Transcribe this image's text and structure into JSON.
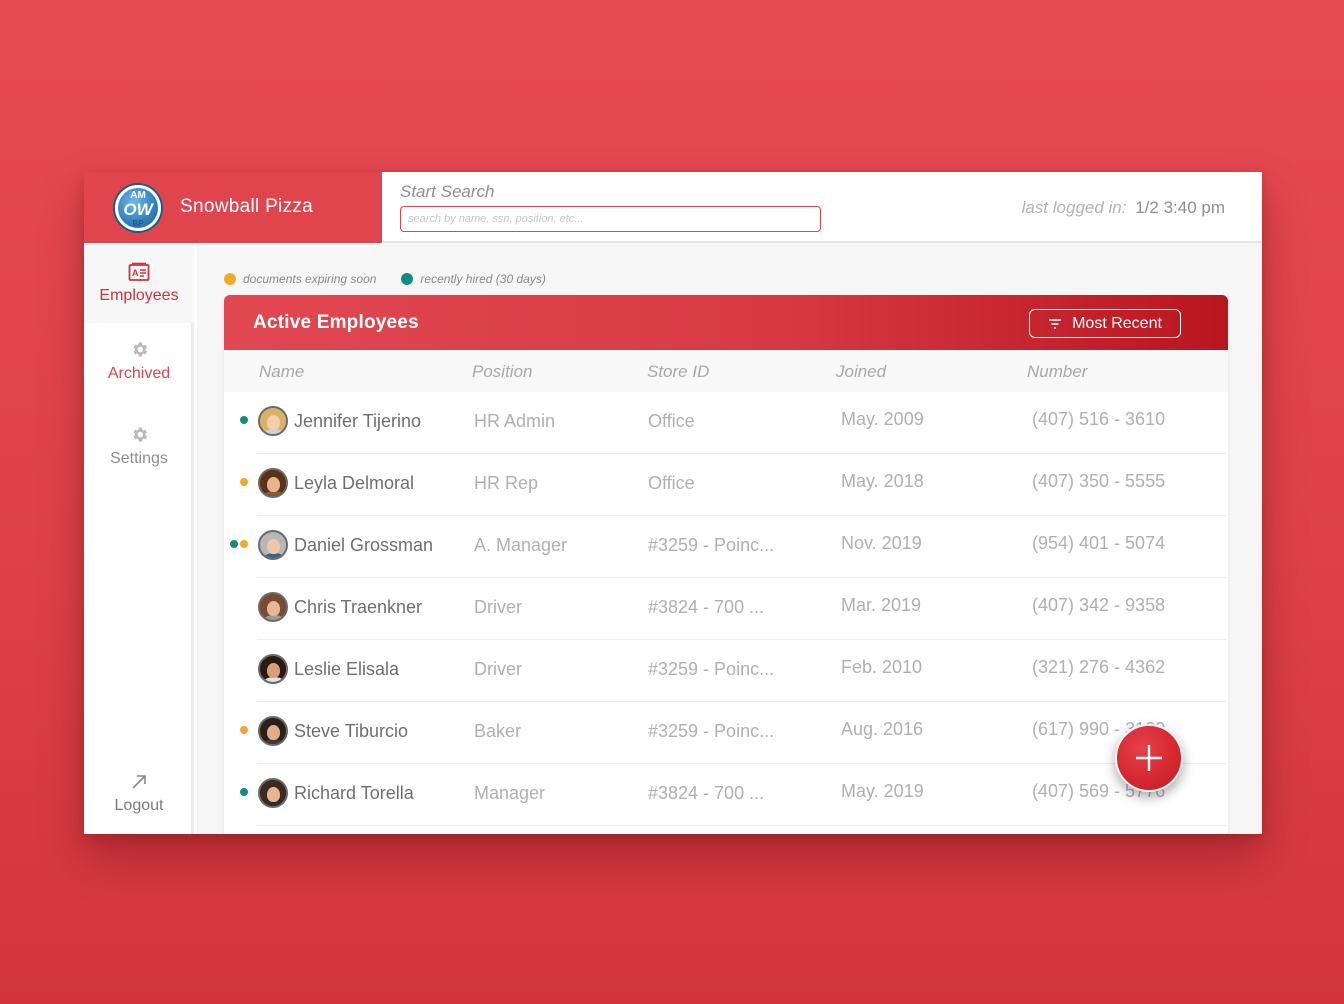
{
  "brand": {
    "name": "Snowball Pizza",
    "logo_top": "AM",
    "logo_mid": "OW",
    "logo_bottom": "BP"
  },
  "search": {
    "label": "Start Search",
    "placeholder": "search by name, ssn, position, etc..."
  },
  "session": {
    "last_logged_label": "last logged in:",
    "last_logged_value": "1/2 3:40 pm"
  },
  "sidebar": {
    "items": [
      {
        "label": "Employees",
        "icon": "id-card-icon",
        "active": true
      },
      {
        "label": "Archived",
        "icon": "gear-icon",
        "active": false
      },
      {
        "label": "Settings",
        "icon": "gear-icon",
        "active": false
      }
    ],
    "logout": {
      "label": "Logout",
      "icon": "arrow-up-right-icon"
    }
  },
  "legend": {
    "documents": {
      "label": "documents expiring soon",
      "color": "#f0a92d"
    },
    "recent": {
      "label": "recently hired (30 days)",
      "color": "#158b83"
    }
  },
  "table": {
    "title": "Active Employees",
    "sort_label": "Most Recent",
    "columns": [
      "Name",
      "Position",
      "Store ID",
      "Joined",
      "Number"
    ],
    "rows": [
      {
        "name": "Jennifer Tijerino",
        "position": "HR Admin",
        "store": "Office",
        "joined": "May. 2009",
        "number": "(407) 516 - 3610",
        "indicators": [
          "recent"
        ],
        "skin": "#f3cfae",
        "hair": "#d9b26a",
        "shirt": "#c9d3dc"
      },
      {
        "name": "Leyla Delmoral",
        "position": "HR Rep",
        "store": "Office",
        "joined": "May. 2018",
        "number": "(407) 350 - 5555",
        "indicators": [
          "documents"
        ],
        "skin": "#e8b48d",
        "hair": "#5a3218",
        "shirt": "#8a5a3c"
      },
      {
        "name": "Daniel Grossman",
        "position": "A. Manager",
        "store": "#3259 - Poinc...",
        "joined": "Nov. 2019",
        "number": "(954) 401 - 5074",
        "indicators": [
          "recent",
          "documents"
        ],
        "skin": "#efc6a8",
        "hair": "#b7b7b7",
        "shirt": "#3e5f86"
      },
      {
        "name": "Chris Traenkner",
        "position": "Driver",
        "store": "#3824 - 700 ...",
        "joined": "Mar. 2019",
        "number": "(407) 342 - 9358",
        "indicators": [],
        "skin": "#e8b896",
        "hair": "#7a4b30",
        "shirt": "#9b9b9b"
      },
      {
        "name": "Leslie Elisala",
        "position": "Driver",
        "store": "#3259 - Poinc...",
        "joined": "Feb. 2010",
        "number": "(321) 276 - 4362",
        "indicators": [],
        "skin": "#d8a07a",
        "hair": "#2b1a10",
        "shirt": "#e2e2e2"
      },
      {
        "name": "Steve Tiburcio",
        "position": "Baker",
        "store": "#3259 - Poinc...",
        "joined": "Aug. 2016",
        "number": "(617) 990 - 3120",
        "indicators": [
          "documents"
        ],
        "skin": "#e2ad88",
        "hair": "#2a2018",
        "shirt": "#3b3b3b"
      },
      {
        "name": "Richard Torella",
        "position": "Manager",
        "store": "#3824 - 700 ...",
        "joined": "May. 2019",
        "number": "(407) 569 - 5776",
        "indicators": [
          "recent"
        ],
        "skin": "#e6b592",
        "hair": "#3a2a20",
        "shirt": "#2f2f2f"
      }
    ]
  },
  "fab": {
    "icon": "plus-icon"
  },
  "colors": {
    "accent": "#e0444c",
    "accent_dark": "#b8161f",
    "documents": "#f0a92d",
    "recent": "#158b83"
  }
}
